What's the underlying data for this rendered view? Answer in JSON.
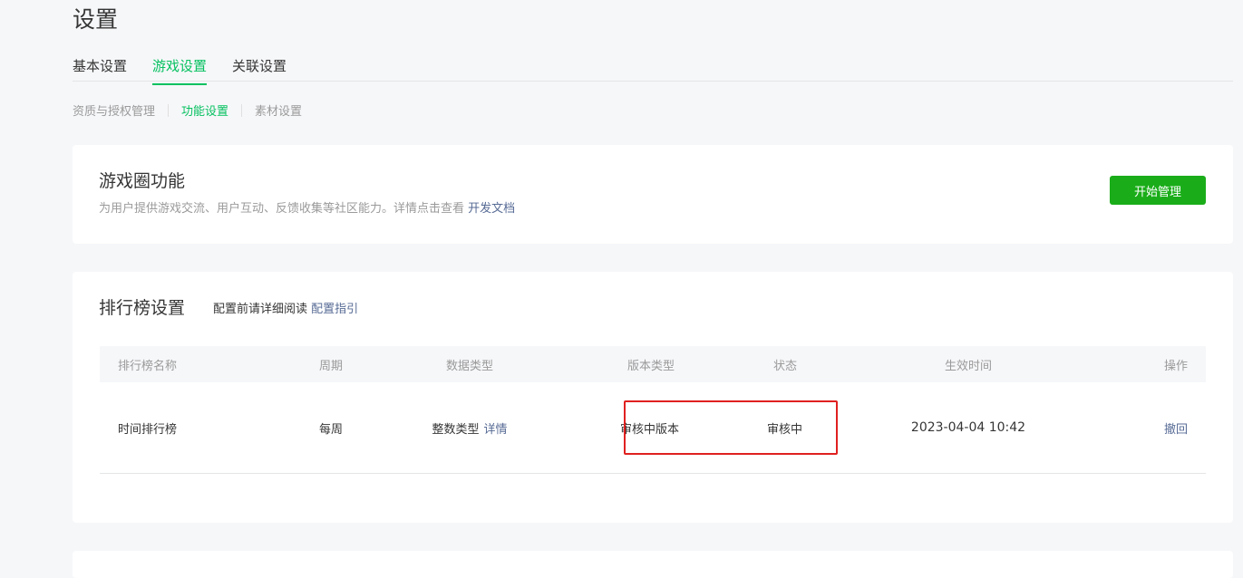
{
  "page": {
    "title": "设置"
  },
  "main_tabs": [
    {
      "label": "基本设置",
      "active": false
    },
    {
      "label": "游戏设置",
      "active": true
    },
    {
      "label": "关联设置",
      "active": false
    }
  ],
  "sub_tabs": [
    {
      "label": "资质与授权管理",
      "active": false
    },
    {
      "label": "功能设置",
      "active": true
    },
    {
      "label": "素材设置",
      "active": false
    }
  ],
  "game_circle": {
    "title": "游戏圈功能",
    "description": "为用户提供游戏交流、用户互动、反馈收集等社区能力。详情点击查看",
    "doc_link": "开发文档",
    "button_label": "开始管理"
  },
  "leaderboard": {
    "title": "排行榜设置",
    "hint": "配置前请详细阅读",
    "guide_link": "配置指引",
    "columns": [
      "排行榜名称",
      "周期",
      "数据类型",
      "版本类型",
      "状态",
      "生效时间",
      "操作"
    ],
    "rows": [
      {
        "name": "时间排行榜",
        "period": "每周",
        "data_type": "整数类型",
        "detail_link": "详情",
        "version_type": "审核中版本",
        "status": "审核中",
        "effective_time": "2023-04-04 10:42",
        "action": "撤回"
      }
    ]
  },
  "colors": {
    "accent_green": "#07c160",
    "button_green": "#1aad19",
    "link_blue": "#576b95",
    "highlight_red": "#e02020"
  }
}
